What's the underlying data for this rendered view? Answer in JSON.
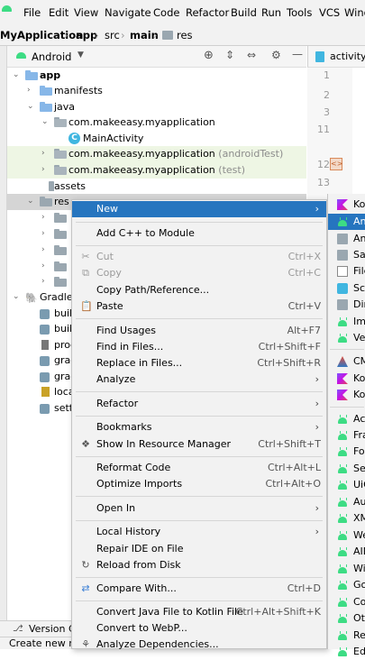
{
  "menubar": {
    "items": [
      "File",
      "Edit",
      "View",
      "Navigate",
      "Code",
      "Refactor",
      "Build",
      "Run",
      "Tools",
      "VCS",
      "Wind"
    ]
  },
  "breadcrumb": {
    "items": [
      "MyApplication",
      "app",
      "src",
      "main",
      "res"
    ]
  },
  "project_panel": {
    "view_mode": "Android",
    "tree": [
      {
        "label": "app",
        "level": 0,
        "expanded": true
      },
      {
        "label": "manifests",
        "level": 1,
        "expanded": false
      },
      {
        "label": "java",
        "level": 1,
        "expanded": true
      },
      {
        "label": "com.makeeasy.myapplication",
        "level": 2,
        "expanded": true
      },
      {
        "label": "MainActivity",
        "level": 3
      },
      {
        "label": "com.makeeasy.myapplication",
        "suffix": "(androidTest)",
        "level": 2,
        "expanded": false
      },
      {
        "label": "com.makeeasy.myapplication",
        "suffix": "(test)",
        "level": 2,
        "expanded": false
      },
      {
        "label": "assets",
        "level": 1
      },
      {
        "label": "res",
        "level": 1,
        "expanded": true
      },
      {
        "label": "Gradle",
        "level": 0,
        "expanded": true
      },
      {
        "label": "buil",
        "level": 1
      },
      {
        "label": "buil",
        "level": 1
      },
      {
        "label": "prog",
        "level": 1
      },
      {
        "label": "grad",
        "level": 1
      },
      {
        "label": "grad",
        "level": 1
      },
      {
        "label": "local",
        "level": 1
      },
      {
        "label": "sett",
        "level": 1
      }
    ]
  },
  "editor": {
    "tab": "activity_",
    "line_numbers": [
      "1",
      "2",
      "3",
      "11",
      "12",
      "13"
    ]
  },
  "context_menu": {
    "items": [
      {
        "label": "New",
        "submenu": true,
        "selected": true
      },
      {
        "label": "Add C++ to Module"
      },
      {
        "label": "Cut",
        "shortcut": "Ctrl+X",
        "disabled": true,
        "icon": "scissors-icon"
      },
      {
        "label": "Copy",
        "shortcut": "Ctrl+C",
        "disabled": true,
        "icon": "copy-icon"
      },
      {
        "label": "Copy Path/Reference..."
      },
      {
        "label": "Paste",
        "shortcut": "Ctrl+V",
        "icon": "paste-icon"
      },
      {
        "label": "Find Usages",
        "shortcut": "Alt+F7"
      },
      {
        "label": "Find in Files...",
        "shortcut": "Ctrl+Shift+F"
      },
      {
        "label": "Replace in Files...",
        "shortcut": "Ctrl+Shift+R"
      },
      {
        "label": "Analyze",
        "submenu": true
      },
      {
        "label": "Refactor",
        "submenu": true
      },
      {
        "label": "Bookmarks",
        "submenu": true
      },
      {
        "label": "Show In Resource Manager",
        "shortcut": "Ctrl+Shift+T",
        "icon": "resource-manager-icon"
      },
      {
        "label": "Reformat Code",
        "shortcut": "Ctrl+Alt+L"
      },
      {
        "label": "Optimize Imports",
        "shortcut": "Ctrl+Alt+O"
      },
      {
        "label": "Open In",
        "submenu": true
      },
      {
        "label": "Local History",
        "submenu": true
      },
      {
        "label": "Repair IDE on File"
      },
      {
        "label": "Reload from Disk",
        "icon": "reload-icon"
      },
      {
        "label": "Compare With...",
        "shortcut": "Ctrl+D",
        "icon": "compare-icon"
      },
      {
        "label": "Convert Java File to Kotlin File",
        "shortcut": "Ctrl+Alt+Shift+K"
      },
      {
        "label": "Convert to WebP..."
      },
      {
        "label": "Analyze Dependencies...",
        "icon": "dependencies-icon"
      }
    ]
  },
  "submenu": {
    "items": [
      {
        "label": "Ko",
        "icon": "kotlin"
      },
      {
        "label": "An",
        "icon": "android",
        "selected": true
      },
      {
        "label": "An",
        "icon": "dir"
      },
      {
        "label": "Sa",
        "icon": "dir"
      },
      {
        "label": "File",
        "icon": "file"
      },
      {
        "label": "Scr",
        "icon": "scratch"
      },
      {
        "label": "Dir",
        "icon": "dir"
      },
      {
        "label": "Ima",
        "icon": "android"
      },
      {
        "label": "Vec",
        "icon": "android"
      },
      {
        "label": "CM",
        "icon": "cmake"
      },
      {
        "label": "Kot",
        "icon": "kotlin"
      },
      {
        "label": "Kot",
        "icon": "kotlin"
      },
      {
        "label": "Act",
        "icon": "android"
      },
      {
        "label": "Fra",
        "icon": "android"
      },
      {
        "label": "Fol",
        "icon": "android"
      },
      {
        "label": "Ser",
        "icon": "android"
      },
      {
        "label": "UiC",
        "icon": "android"
      },
      {
        "label": "Aut",
        "icon": "android"
      },
      {
        "label": "XM",
        "icon": "android"
      },
      {
        "label": "We",
        "icon": "android"
      },
      {
        "label": "AID",
        "icon": "android"
      },
      {
        "label": "Wid",
        "icon": "android"
      },
      {
        "label": "Go",
        "icon": "android"
      },
      {
        "label": "Cor",
        "icon": "android"
      },
      {
        "label": "Oth",
        "icon": "android"
      },
      {
        "label": "Res",
        "icon": "android"
      },
      {
        "label": "Edi",
        "icon": "android"
      }
    ]
  },
  "bottom": {
    "version_control": "Version Co",
    "status": "Create new res"
  }
}
